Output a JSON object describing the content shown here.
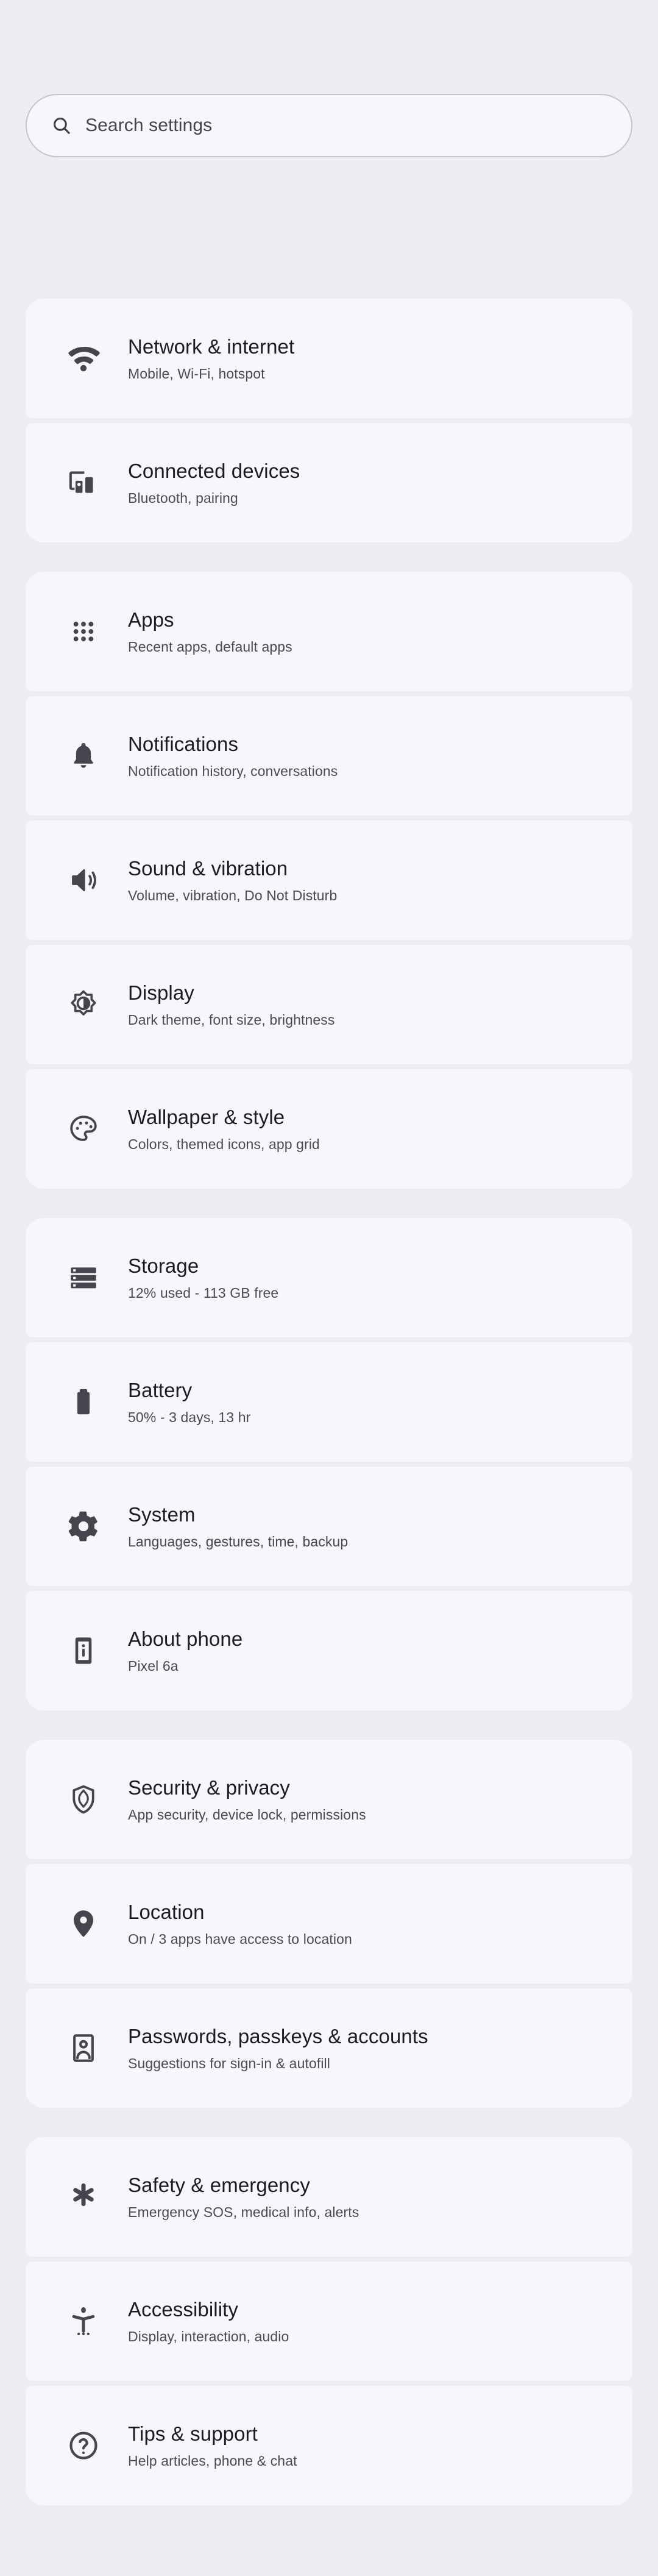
{
  "search": {
    "icon": "search-icon",
    "placeholder": "Search settings",
    "value": ""
  },
  "colors": {
    "page_background": "#edecf0",
    "card_background": "#f7f6fb",
    "title_text": "#1c1b20",
    "subtitle_text": "#4a4a52",
    "icon": "#45454d",
    "search_border": "#c6c5ce"
  },
  "groups": [
    {
      "id": "connectivity",
      "items": [
        {
          "icon": "wifi-icon",
          "title": "Network & internet",
          "subtitle": "Mobile, Wi-Fi, hotspot"
        },
        {
          "icon": "connected-devices-icon",
          "title": "Connected devices",
          "subtitle": "Bluetooth, pairing"
        }
      ]
    },
    {
      "id": "apps-and-media",
      "items": [
        {
          "icon": "apps-grid-icon",
          "title": "Apps",
          "subtitle": "Recent apps, default apps"
        },
        {
          "icon": "bell-icon",
          "title": "Notifications",
          "subtitle": "Notification history, conversations"
        },
        {
          "icon": "volume-up-icon",
          "title": "Sound & vibration",
          "subtitle": "Volume, vibration, Do Not Disturb"
        },
        {
          "icon": "brightness-icon",
          "title": "Display",
          "subtitle": "Dark theme, font size, brightness"
        },
        {
          "icon": "palette-icon",
          "title": "Wallpaper & style",
          "subtitle": "Colors, themed icons, app grid"
        }
      ]
    },
    {
      "id": "device",
      "items": [
        {
          "icon": "storage-icon",
          "title": "Storage",
          "subtitle": "12% used - 113 GB free"
        },
        {
          "icon": "battery-icon",
          "title": "Battery",
          "subtitle": "50% - 3 days, 13 hr"
        },
        {
          "icon": "gear-icon",
          "title": "System",
          "subtitle": "Languages, gestures, time, backup"
        },
        {
          "icon": "phone-info-icon",
          "title": "About phone",
          "subtitle": "Pixel 6a"
        }
      ]
    },
    {
      "id": "privacy",
      "items": [
        {
          "icon": "shield-icon",
          "title": "Security & privacy",
          "subtitle": "App security, device lock, permissions"
        },
        {
          "icon": "location-pin-icon",
          "title": "Location",
          "subtitle": "On / 3 apps have access to location"
        },
        {
          "icon": "passkey-badge-icon",
          "title": "Passwords, passkeys & accounts",
          "subtitle": "Suggestions for sign-in & autofill"
        }
      ]
    },
    {
      "id": "support",
      "items": [
        {
          "icon": "emergency-star-icon",
          "title": "Safety & emergency",
          "subtitle": "Emergency SOS, medical info, alerts"
        },
        {
          "icon": "accessibility-icon",
          "title": "Accessibility",
          "subtitle": "Display, interaction, audio"
        },
        {
          "icon": "help-circle-icon",
          "title": "Tips & support",
          "subtitle": "Help articles, phone & chat"
        }
      ]
    }
  ]
}
